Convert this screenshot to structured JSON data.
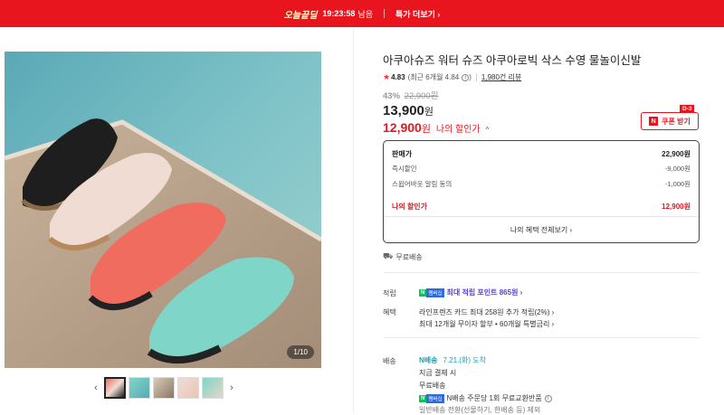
{
  "banner": {
    "tag": "오늘끝딜",
    "time": "19:23:58",
    "remaining": "남음",
    "more": "특가 더보기 ›"
  },
  "gallery": {
    "pager": "1/10"
  },
  "product": {
    "title": "아쿠아슈즈 워터 슈즈 아쿠아로빅 삭스 수영 물놀이신발",
    "rating_score": "4.83",
    "rating_recent": "(최근 6개월 4.84",
    "rating_recent_close": ")",
    "review_count": "1,980건 리뷰",
    "discount_rate": "43%",
    "original_price": "22,900원",
    "price": "13,900",
    "price_unit": "원",
    "my_price": "12,900",
    "my_price_unit": "원",
    "my_price_label": "나의 할인가",
    "my_price_caret": "^"
  },
  "coupon": {
    "dday": "D-3",
    "label": "쿠폰 받기",
    "badge": "N"
  },
  "breakdown": {
    "rows": [
      {
        "label": "판매가",
        "value": "22,900원"
      },
      {
        "label": "즉시할인",
        "value": "-9,000원"
      },
      {
        "label": "스윕어바웃 알림 동의",
        "value": "-1,000원"
      },
      {
        "label": "나의 할인가",
        "value": "12,900원"
      }
    ],
    "footer": "나의 혜택 전체보기 ›"
  },
  "shipping": {
    "label": "무료배송"
  },
  "rewards": {
    "label": "적립",
    "npay_n": "N",
    "npay_m": "멤버십",
    "text": "최대 적립 포인트 865원 ›"
  },
  "benefits": {
    "label": "혜택",
    "line1": "라인프렌즈 카드 최대 258원 추가 적립(2%) ›",
    "line2": "최대 12개월 무이자 할부 • 60개월 특별금리 ›"
  },
  "delivery": {
    "label": "배송",
    "nship_badge": "N배송",
    "date": "7.21.(화) 도착",
    "line1": "지금 결제 시",
    "line2": "무료배송",
    "npay_n": "N",
    "npay_m": "멤버십",
    "line3": "N배송 주문당 1회 무료교환반품",
    "line4": "일반배송 전환(선물하기, 한배송 등) 제외"
  },
  "colors": {
    "brand_red": "#e8151e",
    "npay_green": "#03c75a",
    "point_purple": "#5b3fd1",
    "nship_teal": "#0aa8b8"
  }
}
